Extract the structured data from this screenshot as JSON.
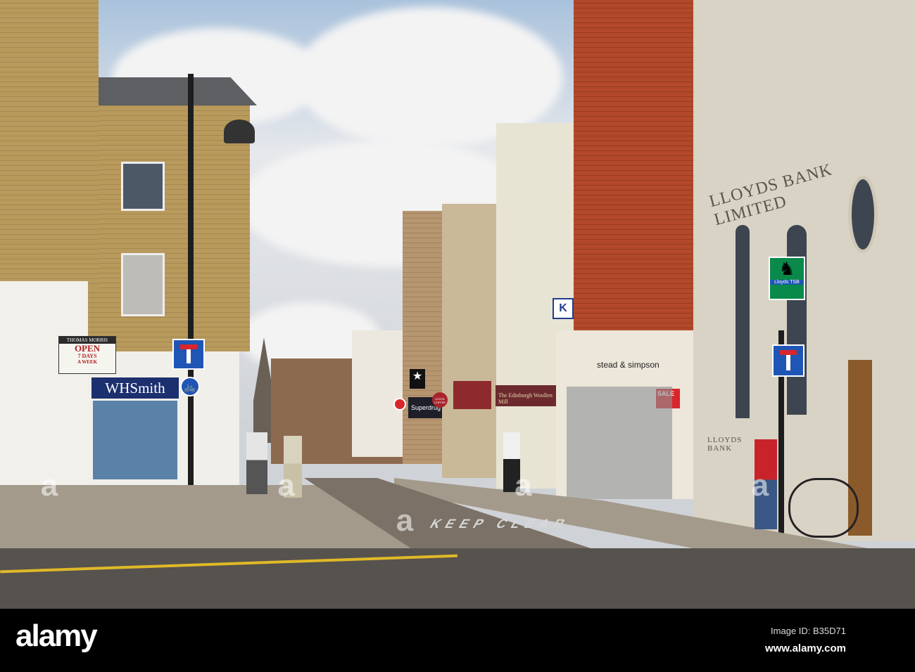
{
  "colors": {
    "sky": "#e6e8ec",
    "brick_yellow": "#b89a5c",
    "brick_red": "#b2492a",
    "stone": "#d9d3c6",
    "sign_blue": "#1f55b5",
    "whsmith_blue": "#1c2f6e",
    "lloyds_green": "#0a8a4a"
  },
  "signs": {
    "newsagent": "THOMAS MORRIS",
    "open": "OPEN",
    "days": "7 DAYS",
    "week": "A WEEK",
    "whsmith": "WHSmith",
    "bank_facade": "LLOYDS BANK LIMITED",
    "bank_plaque": "LLOYDS BANK",
    "lloyds_tsb": "Lloyds TSB",
    "stead": "stead & simpson",
    "sale": "SALE",
    "woollen": "The Edinburgh Woollen Mill",
    "costa": "COSTA COFFEE",
    "superdrug": "Superdrug",
    "k_sign": "K"
  },
  "road": {
    "marking": "KEEP CLEAR"
  },
  "watermark": {
    "logo": "alamy",
    "image_id": "Image ID: B35D71",
    "url": "www.alamy.com"
  }
}
